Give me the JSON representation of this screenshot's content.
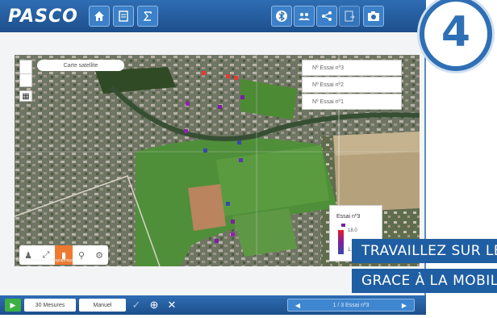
{
  "app": {
    "logo": "PASCO"
  },
  "toolbar": {
    "left_buttons": [
      {
        "icon": "home-icon"
      },
      {
        "icon": "document-icon"
      },
      {
        "icon": "sigma-icon"
      }
    ],
    "right_buttons": [
      {
        "icon": "bluetooth-icon"
      },
      {
        "icon": "users-icon"
      },
      {
        "icon": "share-icon"
      },
      {
        "icon": "export-icon"
      },
      {
        "icon": "camera-icon"
      }
    ]
  },
  "badge": {
    "number": "4"
  },
  "map": {
    "map_type_button": "Carte satellite",
    "layers": [
      "Nº Essai nº3",
      "Nº Essai nº2",
      "Nº Essai nº1"
    ],
    "legend": {
      "title": "Essai nº3",
      "max": "18.0",
      "min": "1.9"
    },
    "attribution": "Google  Données cartographiques",
    "tools": [
      "pin-person-icon",
      "fullscreen-icon",
      "bar-chart-icon",
      "location-pin-icon",
      "settings-icon"
    ]
  },
  "overlay": {
    "line1": "TRAVAILLEZ SUR LE TERRAIN",
    "line2": "GRACE À LA MOBILITÉ"
  },
  "bottombar": {
    "mode_value": "30 Mesures",
    "sampling_value": "Manuel",
    "pager_label": "1 / 3 Essai nº3",
    "colors": {
      "play": "#3cb043",
      "bar": "#1d4f8c"
    }
  }
}
